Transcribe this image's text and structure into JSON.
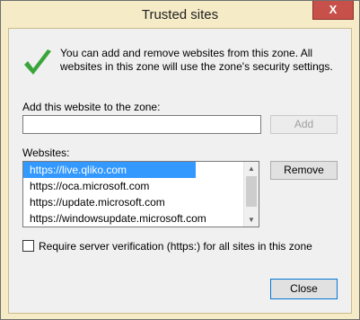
{
  "window": {
    "title": "Trusted sites",
    "close_glyph": "X"
  },
  "intro_text": "You can add and remove websites from this zone. All websites in this zone will use the zone's security settings.",
  "add_section": {
    "label": "Add this website to the zone:",
    "value": "",
    "add_button": "Add"
  },
  "websites": {
    "label": "Websites:",
    "items": [
      "https://live.qliko.com",
      "https://oca.microsoft.com",
      "https://update.microsoft.com",
      "https://windowsupdate.microsoft.com"
    ],
    "remove_button": "Remove"
  },
  "require_https": {
    "label": "Require server verification (https:) for all sites in this zone",
    "checked": false
  },
  "close_button": "Close",
  "icons": {
    "check": "green-checkmark-icon",
    "scroll_up": "chevron-up-icon",
    "scroll_down": "chevron-down-icon"
  },
  "colors": {
    "frame": "#f5ebc6",
    "close_x": "#c7504a",
    "selection": "#3399ff",
    "check_green": "#3aa53a"
  }
}
